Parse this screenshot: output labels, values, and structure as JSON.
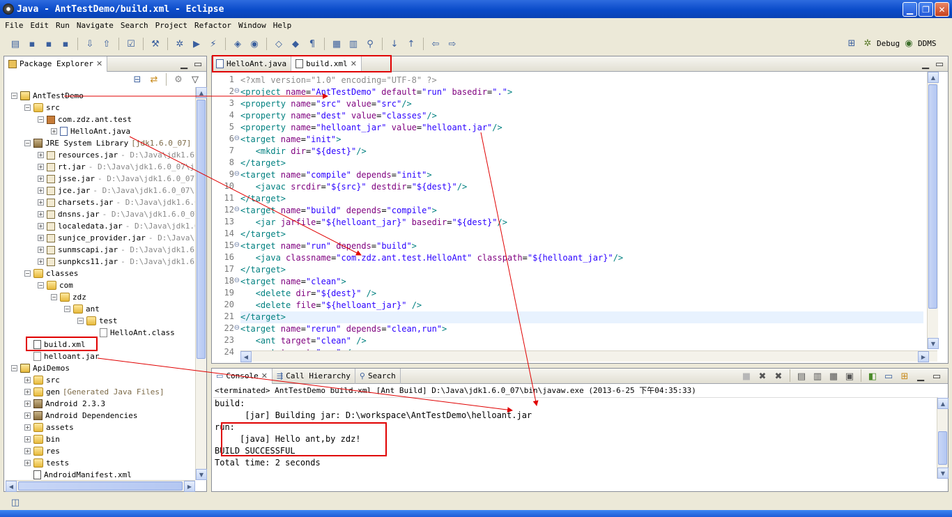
{
  "window": {
    "title": "Java - AntTestDemo/build.xml - Eclipse",
    "minimize": "▁",
    "maximize": "❐",
    "close": "✕"
  },
  "menu": [
    "File",
    "Edit",
    "Run",
    "Navigate",
    "Search",
    "Project",
    "Refactor",
    "Window",
    "Help"
  ],
  "toolbar": {
    "icons": [
      "new-icon",
      "save-icon",
      "save-all-icon",
      "print-icon",
      "sep",
      "import-icon",
      "export-icon",
      "sep",
      "tasks-icon",
      "sep",
      "new-package-icon",
      "sep",
      "debug-icon",
      "run-icon",
      "external-tools-icon",
      "sep",
      "new-java-project-icon",
      "new-class-icon",
      "sep",
      "generic-1-icon",
      "generic-2-icon",
      "generic-3-icon",
      "sep",
      "open-type-icon",
      "open-task-icon",
      "search-icon",
      "sep",
      "next-annotation-icon",
      "prev-annotation-icon",
      "sep",
      "back-icon",
      "forward-icon"
    ],
    "glyphs": [
      "▤",
      "▪",
      "▪",
      "▪",
      "",
      "⇩",
      "⇧",
      "",
      "☑",
      "",
      "⚒",
      "",
      "✲",
      "▶",
      "⚡",
      "",
      "◈",
      "◉",
      "",
      "◇",
      "◆",
      "¶",
      "",
      "▦",
      "▥",
      "⚲",
      "",
      "↓",
      "↑",
      "",
      "⇦",
      "⇨"
    ]
  },
  "perspectives": {
    "debug": "Debug",
    "ddms": "DDMS"
  },
  "package_explorer": {
    "title": "Package Explorer",
    "tree": [
      {
        "label": "AntTestDemo",
        "indent": 0,
        "exp": "−",
        "icon": "proj"
      },
      {
        "label": "src",
        "indent": 1,
        "exp": "−",
        "icon": "folder"
      },
      {
        "label": "com.zdz.ant.test",
        "indent": 2,
        "exp": "−",
        "icon": "pkg"
      },
      {
        "label": "HelloAnt.java",
        "indent": 3,
        "exp": "+",
        "icon": "jfile"
      },
      {
        "label": "JRE System Library",
        "extra": "[jdk1.6.0_07]",
        "indent": 1,
        "exp": "−",
        "icon": "lib"
      },
      {
        "label": "resources.jar",
        "extra": "- D:\\Java\\jdk1.6.0",
        "indent": 2,
        "exp": "+",
        "icon": "jar"
      },
      {
        "label": "rt.jar",
        "extra": "- D:\\Java\\jdk1.6.0_07\\jre",
        "indent": 2,
        "exp": "+",
        "icon": "jar"
      },
      {
        "label": "jsse.jar",
        "extra": "- D:\\Java\\jdk1.6.0_07\\j",
        "indent": 2,
        "exp": "+",
        "icon": "jar"
      },
      {
        "label": "jce.jar",
        "extra": "- D:\\Java\\jdk1.6.0_07\\jr",
        "indent": 2,
        "exp": "+",
        "icon": "jar"
      },
      {
        "label": "charsets.jar",
        "extra": "- D:\\Java\\jdk1.6.0_",
        "indent": 2,
        "exp": "+",
        "icon": "jar"
      },
      {
        "label": "dnsns.jar",
        "extra": "- D:\\Java\\jdk1.6.0_07\\",
        "indent": 2,
        "exp": "+",
        "icon": "jar"
      },
      {
        "label": "localedata.jar",
        "extra": "- D:\\Java\\jdk1.6.",
        "indent": 2,
        "exp": "+",
        "icon": "jar"
      },
      {
        "label": "sunjce_provider.jar",
        "extra": "- D:\\Java\\jd",
        "indent": 2,
        "exp": "+",
        "icon": "jar"
      },
      {
        "label": "sunmscapi.jar",
        "extra": "- D:\\Java\\jdk1.6.0",
        "indent": 2,
        "exp": "+",
        "icon": "jar"
      },
      {
        "label": "sunpkcs11.jar",
        "extra": "- D:\\Java\\jdk1.6.0",
        "indent": 2,
        "exp": "+",
        "icon": "jar"
      },
      {
        "label": "classes",
        "indent": 1,
        "exp": "−",
        "icon": "folder"
      },
      {
        "label": "com",
        "indent": 2,
        "exp": "−",
        "icon": "folder"
      },
      {
        "label": "zdz",
        "indent": 3,
        "exp": "−",
        "icon": "folder"
      },
      {
        "label": "ant",
        "indent": 4,
        "exp": "−",
        "icon": "folder"
      },
      {
        "label": "test",
        "indent": 5,
        "exp": "−",
        "icon": "folder"
      },
      {
        "label": "HelloAnt.class",
        "indent": 6,
        "exp": "",
        "icon": "plain"
      },
      {
        "label": "build.xml",
        "indent": 1,
        "exp": "",
        "icon": "xmlfile"
      },
      {
        "label": "helloant.jar",
        "indent": 1,
        "exp": "",
        "icon": "plain"
      },
      {
        "label": "ApiDemos",
        "indent": 0,
        "exp": "−",
        "icon": "proj"
      },
      {
        "label": "src",
        "indent": 1,
        "exp": "+",
        "icon": "folder"
      },
      {
        "label": "gen",
        "extra": "[Generated Java Files]",
        "indent": 1,
        "exp": "+",
        "icon": "folder"
      },
      {
        "label": "Android 2.3.3",
        "indent": 1,
        "exp": "+",
        "icon": "lib"
      },
      {
        "label": "Android Dependencies",
        "indent": 1,
        "exp": "+",
        "icon": "lib"
      },
      {
        "label": "assets",
        "indent": 1,
        "exp": "+",
        "icon": "folder"
      },
      {
        "label": "bin",
        "indent": 1,
        "exp": "+",
        "icon": "folder"
      },
      {
        "label": "res",
        "indent": 1,
        "exp": "+",
        "icon": "folder"
      },
      {
        "label": "tests",
        "indent": 1,
        "exp": "+",
        "icon": "folder"
      },
      {
        "label": "AndroidManifest.xml",
        "indent": 1,
        "exp": "",
        "icon": "xmlfile"
      }
    ]
  },
  "editor": {
    "tabs": [
      {
        "label": "HelloAnt.java",
        "active": false
      },
      {
        "label": "build.xml",
        "active": true
      }
    ],
    "lines": [
      {
        "n": "1",
        "fold": "",
        "code": "<?xml version=\"1.0\" encoding=\"UTF-8\" ?>"
      },
      {
        "n": "2",
        "fold": "⊖",
        "code": "<project name=\"AntTestDemo\" default=\"run\" basedir=\".\">"
      },
      {
        "n": "3",
        "fold": "",
        "code": "<property name=\"src\" value=\"src\"/>"
      },
      {
        "n": "4",
        "fold": "",
        "code": "<property name=\"dest\" value=\"classes\"/>"
      },
      {
        "n": "5",
        "fold": "",
        "code": "<property name=\"helloant_jar\" value=\"helloant.jar\"/>"
      },
      {
        "n": "6",
        "fold": "⊖",
        "code": "<target name=\"init\">"
      },
      {
        "n": "7",
        "fold": "",
        "code": "   <mkdir dir=\"${dest}\"/>"
      },
      {
        "n": "8",
        "fold": "",
        "code": "</target>"
      },
      {
        "n": "9",
        "fold": "⊖",
        "code": "<target name=\"compile\" depends=\"init\">"
      },
      {
        "n": "10",
        "fold": "",
        "code": "   <javac srcdir=\"${src}\" destdir=\"${dest}\"/>"
      },
      {
        "n": "11",
        "fold": "",
        "code": "</target>"
      },
      {
        "n": "12",
        "fold": "⊖",
        "code": "<target name=\"build\" depends=\"compile\">"
      },
      {
        "n": "13",
        "fold": "",
        "code": "   <jar jarfile=\"${helloant_jar}\" basedir=\"${dest}\"/>"
      },
      {
        "n": "14",
        "fold": "",
        "code": "</target>"
      },
      {
        "n": "15",
        "fold": "⊖",
        "code": "<target name=\"run\" depends=\"build\">"
      },
      {
        "n": "16",
        "fold": "",
        "code": "   <java classname=\"com.zdz.ant.test.HelloAnt\" classpath=\"${helloant_jar}\"/>"
      },
      {
        "n": "17",
        "fold": "",
        "code": "</target>"
      },
      {
        "n": "18",
        "fold": "⊖",
        "code": "<target name=\"clean\">"
      },
      {
        "n": "19",
        "fold": "",
        "code": "   <delete dir=\"${dest}\" />"
      },
      {
        "n": "20",
        "fold": "",
        "code": "   <delete file=\"${helloant_jar}\" />"
      },
      {
        "n": "21",
        "fold": "",
        "code": "</target>"
      },
      {
        "n": "22",
        "fold": "⊖",
        "code": "<target name=\"rerun\" depends=\"clean,run\">"
      },
      {
        "n": "23",
        "fold": "",
        "code": "   <ant target=\"clean\" />"
      },
      {
        "n": "24",
        "fold": "",
        "code": "   <ant target=\"run\" />"
      }
    ],
    "highlight_line": "21"
  },
  "console": {
    "tabs": [
      "Console",
      "Call Hierarchy",
      "Search"
    ],
    "header": "<terminated> AntTestDemo build.xml [Ant Build] D:\\Java\\jdk1.6.0_07\\bin\\javaw.exe (2013-6-25 下午04:35:33)",
    "lines": [
      "build:",
      "      [jar] Building jar: D:\\workspace\\AntTestDemo\\helloant.jar",
      "run:",
      "     [java] Hello ant,by zdz!",
      "BUILD SUCCESSFUL",
      "Total time: 2 seconds"
    ]
  },
  "colors": {
    "annotation_red": "#E00000",
    "xml_tag": "#008080",
    "xml_attr_name": "#7F007F",
    "xml_attr_value": "#2A00FF"
  }
}
